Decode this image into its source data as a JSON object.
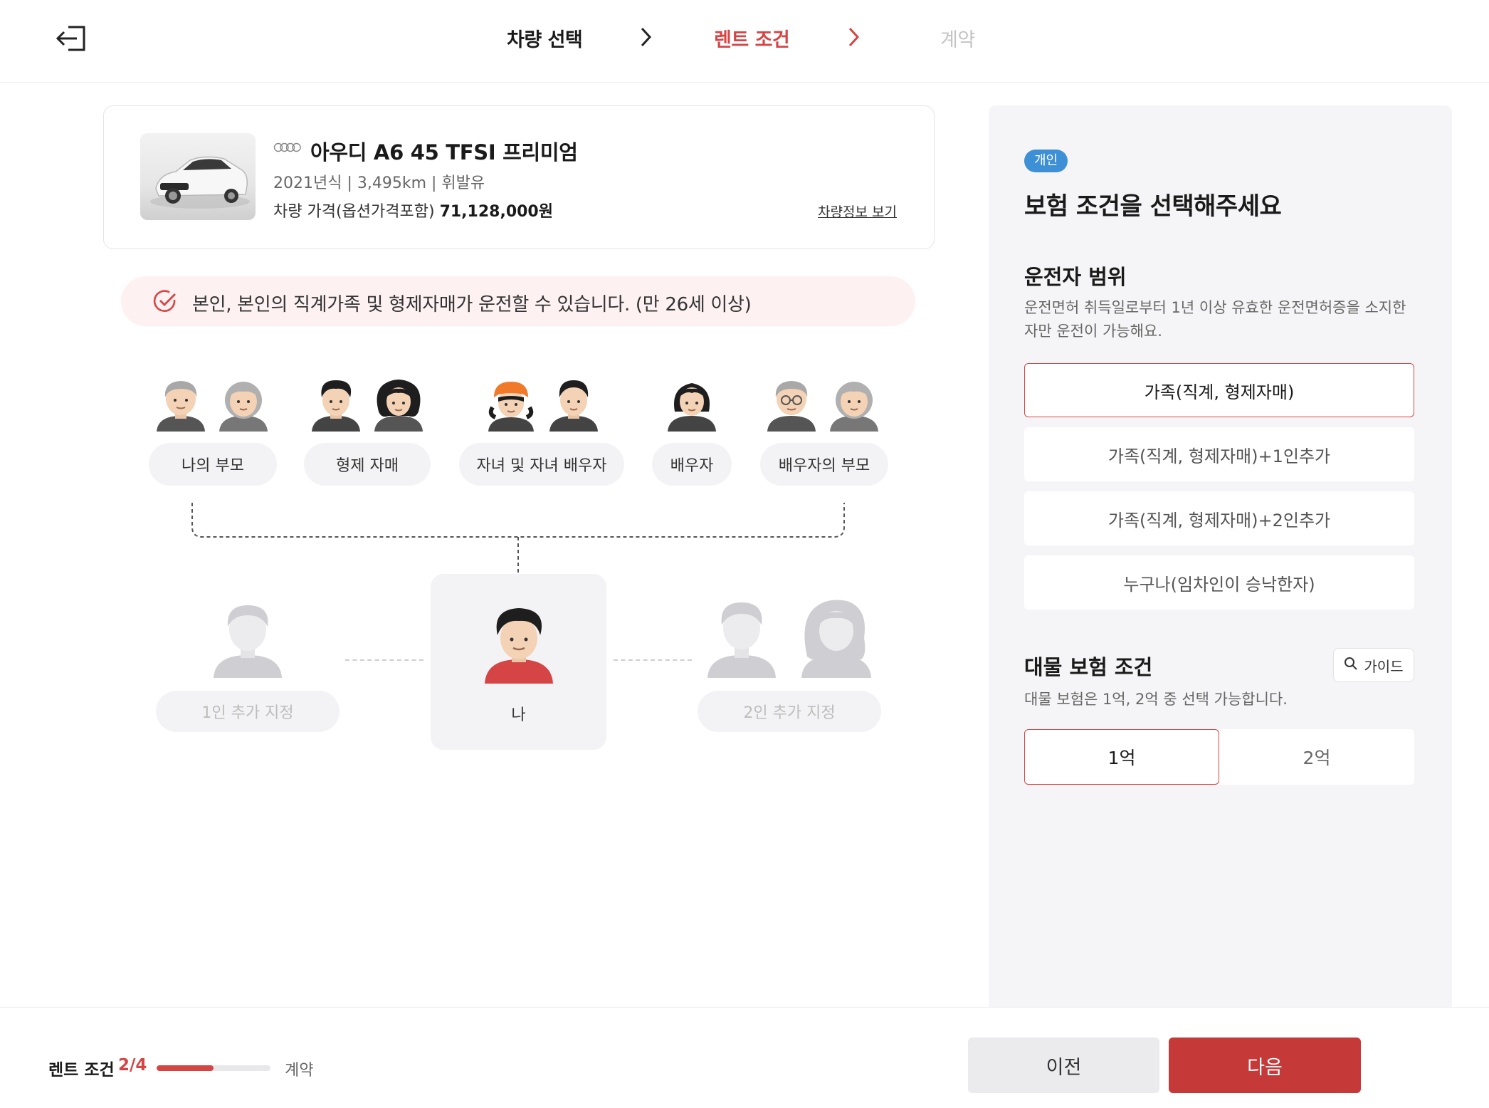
{
  "header": {
    "steps": [
      {
        "label": "차량 선택",
        "state": "done"
      },
      {
        "label": "렌트 조건",
        "state": "active"
      },
      {
        "label": "계약",
        "state": "pending"
      }
    ]
  },
  "car": {
    "name": "아우디 A6 45 TFSI 프리미엄",
    "meta": "2021년식 | 3,495km | 휘발유",
    "price_label": "차량 가격(옵션가격포함)",
    "price_value": "71,128,000원",
    "detail_link": "차량정보 보기"
  },
  "notice": {
    "text": "본인, 본인의 직계가족 및 형제자매가 운전할 수 있습니다. (만 26세 이상)"
  },
  "family": {
    "groups": [
      "나의 부모",
      "형제 자매",
      "자녀 및 자녀 배우자",
      "배우자",
      "배우자의 부모"
    ],
    "extra1": "1인 추가 지정",
    "me": "나",
    "extra2": "2인 추가 지정"
  },
  "panel": {
    "badge": "개인",
    "title": "보험 조건을 선택해주세요",
    "driver_scope": {
      "title": "운전자 범위",
      "desc": "운전면허 취득일로부터 1년 이상 유효한 운전면허증을 소지한 자만 운전이 가능해요.",
      "options": [
        "가족(직계, 형제자매)",
        "가족(직계, 형제자매)+1인추가",
        "가족(직계, 형제자매)+2인추가",
        "누구나(임차인이 승낙한자)"
      ],
      "selected": 0
    },
    "property": {
      "title": "대물 보험 조건",
      "guide": "가이드",
      "desc": "대물 보험은 1억, 2억 중 선택 가능합니다.",
      "options": [
        "1억",
        "2억"
      ],
      "selected": 0
    }
  },
  "footer": {
    "step_label": "렌트 조건",
    "step_count": "2/4",
    "progress": 0.5,
    "next_step": "계약",
    "prev_button": "이전",
    "next_button": "다음"
  },
  "colors": {
    "accent": "#d64545",
    "badge": "#3d8fd6",
    "panel_bg": "#f5f5f7"
  }
}
